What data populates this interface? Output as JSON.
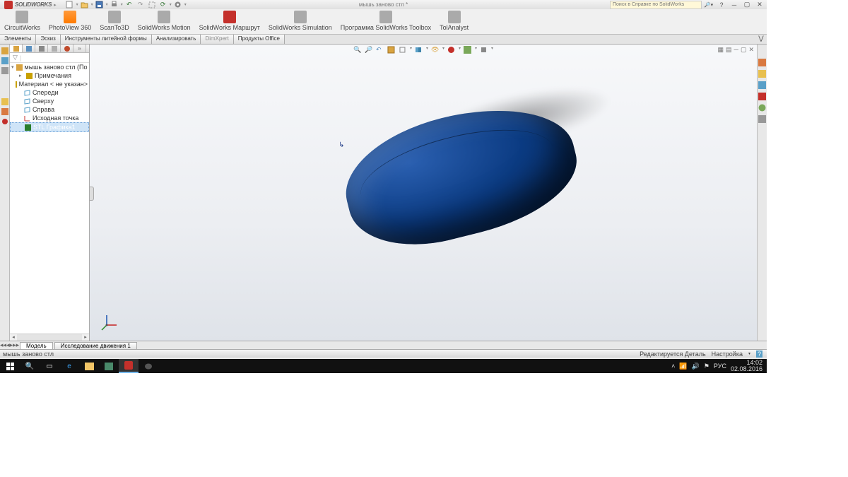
{
  "app": {
    "brand_text": "SOLIDWORKS",
    "document_title": "мышь заново стл *",
    "search_placeholder": "Поиск в Справке по SolidWorks"
  },
  "ribbon": {
    "items": [
      {
        "label": "CircuitWorks"
      },
      {
        "label": "PhotoView 360"
      },
      {
        "label": "ScanTo3D"
      },
      {
        "label": "SolidWorks Motion"
      },
      {
        "label": "SolidWorks Маршрут"
      },
      {
        "label": "SolidWorks Simulation"
      },
      {
        "label": "Программа SolidWorks Toolbox"
      },
      {
        "label": "TolAnalyst"
      }
    ]
  },
  "tabs": {
    "items": [
      {
        "label": "Элементы"
      },
      {
        "label": "Эскиз"
      },
      {
        "label": "Инструменты литейной формы"
      },
      {
        "label": "Анализировать"
      },
      {
        "label": "DimXpert",
        "muted": true
      },
      {
        "label": "Продукты Office"
      }
    ]
  },
  "tree": {
    "root": "мышь заново стл  (По умолч",
    "nodes": [
      {
        "label": "Примечания",
        "color": "#c8a000"
      },
      {
        "label": "Материал < не указан>",
        "color": "#c8a000"
      },
      {
        "label": "Спереди",
        "color": "#5aa0c8"
      },
      {
        "label": "Сверху",
        "color": "#5aa0c8"
      },
      {
        "label": "Справа",
        "color": "#5aa0c8"
      },
      {
        "label": "Исходная точка",
        "color": "#333"
      },
      {
        "label": "STL Графика1",
        "selected": true,
        "color": "#2a7d2a"
      }
    ]
  },
  "bottom_tabs": {
    "items": [
      {
        "label": "Модель",
        "active": true
      },
      {
        "label": "Исследование движения 1"
      }
    ]
  },
  "status": {
    "left": "мышь заново стл",
    "mode": "Редактируется Деталь",
    "custom": "Настройка"
  },
  "taskbar": {
    "lang": "РУС",
    "time": "14:02",
    "date": "02.08.2016"
  }
}
